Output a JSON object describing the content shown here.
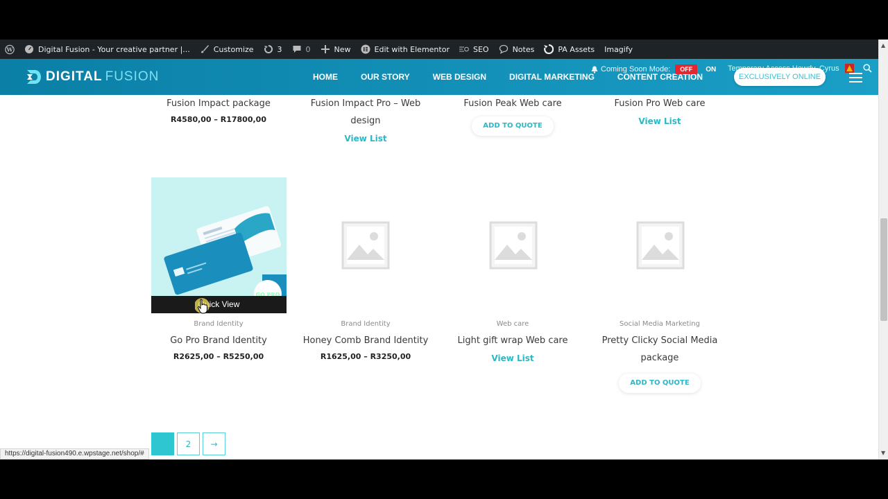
{
  "adminbar": {
    "site_title": "Digital Fusion - Your creative partner |...",
    "customize": "Customize",
    "updates_count": "3",
    "comments_count": "0",
    "new_label": "New",
    "elementor": "Edit with Elementor",
    "seo": "SEO",
    "notes": "Notes",
    "pa_assets": "PA Assets",
    "imagify": "Imagify"
  },
  "header": {
    "logo_main": "DIGITAL",
    "logo_sub": "FUSION",
    "nav": [
      "HOME",
      "OUR STORY",
      "WEB DESIGN",
      "DIGITAL MARKETING",
      "CONTENT CREATION"
    ],
    "coming_soon_label": "Coming Soon Mode:",
    "toggle_off": "OFF",
    "toggle_on": "ON",
    "temp_access": "Temporary Access   Howdy, Cyrus",
    "cta": "EXCLUSIVELY ONLINE"
  },
  "products_top": [
    {
      "title": "Fusion Impact package",
      "price": "R4580,00 – R17800,00"
    },
    {
      "title": "Fusion Impact Pro – Web design",
      "link": "View List"
    },
    {
      "title": "Fusion Peak Web care",
      "button": "ADD TO QUOTE"
    },
    {
      "title": "Fusion Pro Web care",
      "link": "View List"
    }
  ],
  "products_bottom": [
    {
      "category": "Brand Identity",
      "title": "Go Pro Brand Identity",
      "price": "R2625,00 – R5250,00",
      "overlay": "Quick View",
      "badge": "GO PRO"
    },
    {
      "category": "Brand Identity",
      "title": "Honey Comb Brand Identity",
      "price": "R1625,00 – R3250,00"
    },
    {
      "category": "Web care",
      "title": "Light gift wrap Web care",
      "link": "View List"
    },
    {
      "category": "Social Media Marketing",
      "title": "Pretty Clicky Social Media package",
      "button": "ADD TO QUOTE"
    }
  ],
  "pagination": {
    "current": "",
    "page2": "2",
    "next": "→"
  },
  "statusbar": "https://digital-fusion490.e.wpstage.net/shop/#",
  "colors": {
    "accent": "#2bb8c4",
    "header": "#1a9fc7",
    "adminbar": "#1d2327"
  }
}
